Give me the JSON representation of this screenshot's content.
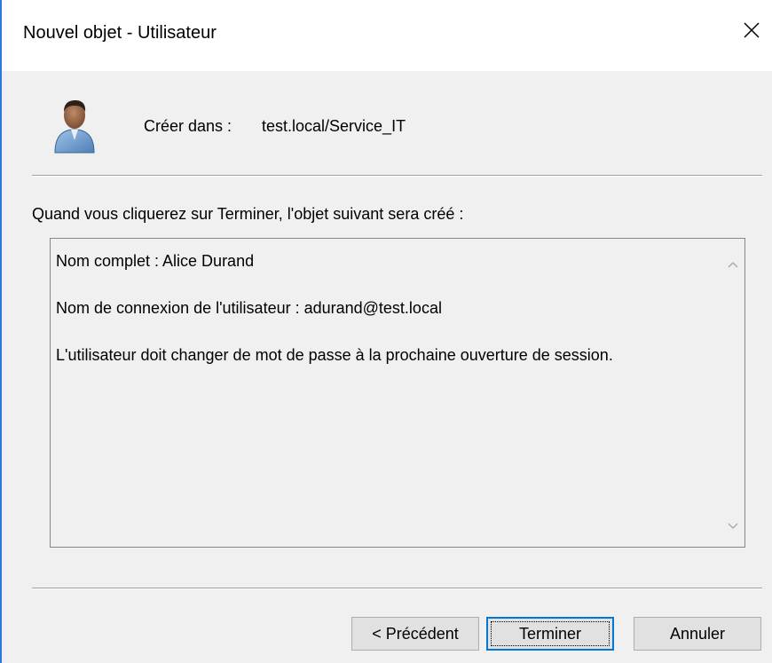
{
  "window": {
    "title": "Nouvel objet - Utilisateur",
    "accent_color": "#2b79d8"
  },
  "header": {
    "create_in_label": "Créer dans :",
    "create_in_path": "test.local/Service_IT",
    "icon": "user-icon"
  },
  "body": {
    "intro": "Quand vous cliquerez sur Terminer, l'objet suivant sera créé :",
    "summary_lines": [
      "Nom complet : Alice Durand",
      "Nom de connexion de l'utilisateur : adurand@test.local",
      "L'utilisateur doit changer de mot de passe à la prochaine ouverture de session."
    ]
  },
  "buttons": {
    "previous": "< Précédent",
    "finish": "Terminer",
    "cancel": "Annuler",
    "focus_color": "#0078d7"
  }
}
